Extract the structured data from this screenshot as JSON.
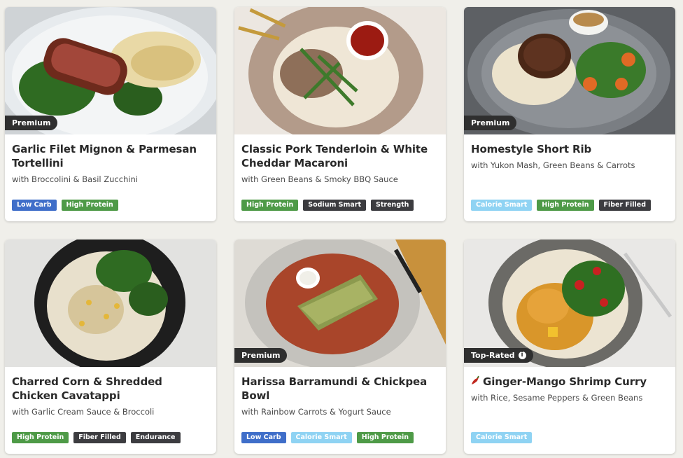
{
  "colors": {
    "tag_blue": "#3f6ec9",
    "tag_green": "#4e9a47",
    "tag_dark": "#3c3c40",
    "tag_light": "#8fd3f3",
    "ribbon": "#2f2f2f"
  },
  "cards": [
    {
      "badge": "Premium",
      "title": "Garlic Filet Mignon & Parmesan Tortellini",
      "subtitle": "with Broccolini & Basil Zucchini",
      "tags": [
        "Low Carb",
        "High Protein"
      ]
    },
    {
      "badge": "",
      "title": "Classic Pork Tenderloin & White Cheddar Macaroni",
      "subtitle": "with Green Beans & Smoky BBQ Sauce",
      "tags": [
        "High Protein",
        "Sodium Smart",
        "Strength"
      ]
    },
    {
      "badge": "Premium",
      "title": "Homestyle Short Rib",
      "subtitle": "with Yukon Mash, Green Beans & Carrots",
      "tags": [
        "Calorie Smart",
        "High Protein",
        "Fiber Filled"
      ]
    },
    {
      "badge": "",
      "title": "Charred Corn & Shredded Chicken Cavatappi",
      "subtitle": "with Garlic Cream Sauce & Broccoli",
      "tags": [
        "High Protein",
        "Fiber Filled",
        "Endurance"
      ]
    },
    {
      "badge": "Premium",
      "title": "Harissa Barramundi & Chickpea Bowl",
      "subtitle": "with Rainbow Carrots & Yogurt Sauce",
      "tags": [
        "Low Carb",
        "Calorie Smart",
        "High Protein"
      ]
    },
    {
      "badge": "Top-Rated",
      "badge_icon": "info-icon",
      "title_icon": "chili-pepper-icon",
      "title": "Ginger-Mango Shrimp Curry",
      "subtitle": "with Rice, Sesame Peppers & Green Beans",
      "tags": [
        "Calorie Smart"
      ]
    }
  ]
}
